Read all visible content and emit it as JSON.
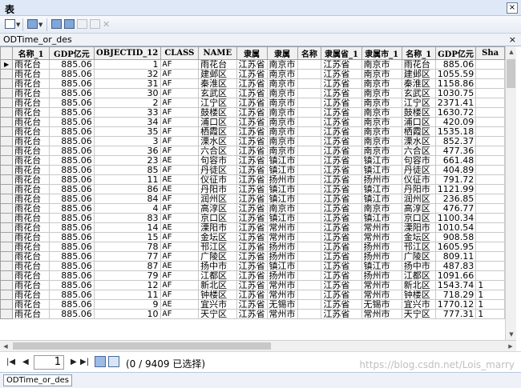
{
  "window": {
    "title": "表",
    "close_glyph": "×"
  },
  "toolbar": {
    "items": [
      {
        "name": "table-options-icon",
        "has_dropdown": true,
        "disabled": false
      },
      {
        "name": "related-tables-icon",
        "has_dropdown": true,
        "disabled": false
      },
      {
        "name": "select-by-attributes-icon",
        "has_dropdown": false,
        "disabled": false
      },
      {
        "name": "switch-selection-icon",
        "has_dropdown": false,
        "disabled": false
      },
      {
        "name": "clear-selection-icon",
        "has_dropdown": false,
        "disabled": true
      },
      {
        "name": "zoom-to-selected-icon",
        "has_dropdown": false,
        "disabled": true
      },
      {
        "name": "delete-selected-icon",
        "has_dropdown": false,
        "disabled": true
      }
    ]
  },
  "tab": {
    "title": "ODTime_or_des",
    "close_glyph": "×"
  },
  "table": {
    "columns": [
      "名称_1",
      "GDP亿元",
      "OBJECTID_12",
      "CLASS",
      "NAME",
      "隶属",
      "隶属",
      "名称",
      "隶属省_1",
      "隶属市_1",
      "名称_1",
      "GDP亿元",
      "Sha"
    ],
    "rows": [
      [
        "雨花台",
        "885.06",
        "1",
        "AF",
        "雨花台",
        "江苏省",
        "南京市",
        "",
        "江苏省",
        "南京市",
        "雨花台",
        "885.06",
        ""
      ],
      [
        "雨花台",
        "885.06",
        "32",
        "AF",
        "建邺区",
        "江苏省",
        "南京市",
        "",
        "江苏省",
        "南京市",
        "建邺区",
        "1055.59",
        ""
      ],
      [
        "雨花台",
        "885.06",
        "31",
        "AF",
        "秦淮区",
        "江苏省",
        "南京市",
        "",
        "江苏省",
        "南京市",
        "秦淮区",
        "1158.86",
        ""
      ],
      [
        "雨花台",
        "885.06",
        "30",
        "AF",
        "玄武区",
        "江苏省",
        "南京市",
        "",
        "江苏省",
        "南京市",
        "玄武区",
        "1030.75",
        ""
      ],
      [
        "雨花台",
        "885.06",
        "2",
        "AF",
        "江宁区",
        "江苏省",
        "南京市",
        "",
        "江苏省",
        "南京市",
        "江宁区",
        "2371.41",
        ""
      ],
      [
        "雨花台",
        "885.06",
        "33",
        "AF",
        "鼓楼区",
        "江苏省",
        "南京市",
        "",
        "江苏省",
        "南京市",
        "鼓楼区",
        "1630.72",
        ""
      ],
      [
        "雨花台",
        "885.06",
        "34",
        "AF",
        "浦口区",
        "江苏省",
        "南京市",
        "",
        "江苏省",
        "南京市",
        "浦口区",
        "420.09",
        ""
      ],
      [
        "雨花台",
        "885.06",
        "35",
        "AF",
        "栖霞区",
        "江苏省",
        "南京市",
        "",
        "江苏省",
        "南京市",
        "栖霞区",
        "1535.18",
        ""
      ],
      [
        "雨花台",
        "885.06",
        "3",
        "AF",
        "溧水区",
        "江苏省",
        "南京市",
        "",
        "江苏省",
        "南京市",
        "溧水区",
        "852.37",
        ""
      ],
      [
        "雨花台",
        "885.06",
        "36",
        "AF",
        "六合区",
        "江苏省",
        "南京市",
        "",
        "江苏省",
        "南京市",
        "六合区",
        "477.36",
        ""
      ],
      [
        "雨花台",
        "885.06",
        "23",
        "AE",
        "句容市",
        "江苏省",
        "镇江市",
        "",
        "江苏省",
        "镇江市",
        "句容市",
        "661.48",
        ""
      ],
      [
        "雨花台",
        "885.06",
        "85",
        "AF",
        "丹徒区",
        "江苏省",
        "镇江市",
        "",
        "江苏省",
        "镇江市",
        "丹徒区",
        "404.89",
        ""
      ],
      [
        "雨花台",
        "885.06",
        "11",
        "AE",
        "仪征市",
        "江苏省",
        "扬州市",
        "",
        "江苏省",
        "扬州市",
        "仪征市",
        "791.72",
        ""
      ],
      [
        "雨花台",
        "885.06",
        "86",
        "AE",
        "丹阳市",
        "江苏省",
        "镇江市",
        "",
        "江苏省",
        "镇江市",
        "丹阳市",
        "1121.99",
        ""
      ],
      [
        "雨花台",
        "885.06",
        "84",
        "AF",
        "润州区",
        "江苏省",
        "镇江市",
        "",
        "江苏省",
        "镇江市",
        "润州区",
        "236.85",
        ""
      ],
      [
        "雨花台",
        "885.06",
        "4",
        "AF",
        "高淳区",
        "江苏省",
        "南京市",
        "",
        "江苏省",
        "南京市",
        "高淳区",
        "476.77",
        ""
      ],
      [
        "雨花台",
        "885.06",
        "83",
        "AF",
        "京口区",
        "江苏省",
        "镇江市",
        "",
        "江苏省",
        "镇江市",
        "京口区",
        "1100.34",
        ""
      ],
      [
        "雨花台",
        "885.06",
        "14",
        "AE",
        "溧阳市",
        "江苏省",
        "常州市",
        "",
        "江苏省",
        "常州市",
        "溧阳市",
        "1010.54",
        ""
      ],
      [
        "雨花台",
        "885.06",
        "15",
        "AF",
        "金坛区",
        "江苏省",
        "常州市",
        "",
        "江苏省",
        "常州市",
        "金坛区",
        "908.58",
        ""
      ],
      [
        "雨花台",
        "885.06",
        "78",
        "AF",
        "邗江区",
        "江苏省",
        "扬州市",
        "",
        "江苏省",
        "扬州市",
        "邗江区",
        "1605.95",
        ""
      ],
      [
        "雨花台",
        "885.06",
        "77",
        "AF",
        "广陵区",
        "江苏省",
        "扬州市",
        "",
        "江苏省",
        "扬州市",
        "广陵区",
        "809.11",
        ""
      ],
      [
        "雨花台",
        "885.06",
        "87",
        "AE",
        "扬中市",
        "江苏省",
        "镇江市",
        "",
        "江苏省",
        "镇江市",
        "扬中市",
        "487.83",
        ""
      ],
      [
        "雨花台",
        "885.06",
        "79",
        "AF",
        "江都区",
        "江苏省",
        "扬州市",
        "",
        "江苏省",
        "扬州市",
        "江都区",
        "1091.66",
        ""
      ],
      [
        "雨花台",
        "885.06",
        "12",
        "AF",
        "新北区",
        "江苏省",
        "常州市",
        "",
        "江苏省",
        "常州市",
        "新北区",
        "1543.74",
        "1"
      ],
      [
        "雨花台",
        "885.06",
        "11",
        "AF",
        "钟楼区",
        "江苏省",
        "常州市",
        "",
        "江苏省",
        "常州市",
        "钟楼区",
        "718.29",
        "1"
      ],
      [
        "雨花台",
        "885.06",
        "9",
        "AE",
        "宜兴市",
        "江苏省",
        "无锡市",
        "",
        "江苏省",
        "无锡市",
        "宜兴市",
        "1770.12",
        "1"
      ],
      [
        "雨花台",
        "885.06",
        "10",
        "AF",
        "天宁区",
        "江苏省",
        "常州市",
        "",
        "江苏省",
        "常州市",
        "天宁区",
        "777.31",
        "1"
      ]
    ]
  },
  "navigator": {
    "first_glyph": "|◀",
    "prev_glyph": "◀",
    "current_page": "1",
    "next_glyph": "▶",
    "last_glyph": "▶|",
    "record_count": "(0 / 9409 已选择)"
  },
  "bottom_tab": {
    "label": "ODTime_or_des"
  },
  "watermark": "https://blog.csdn.net/Lois_marry"
}
